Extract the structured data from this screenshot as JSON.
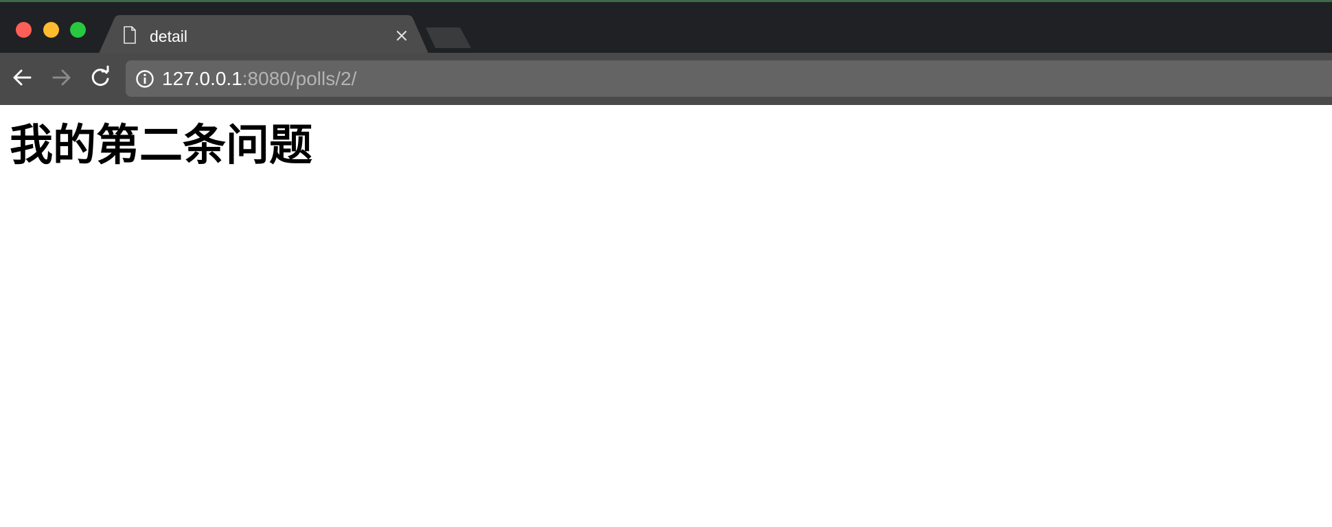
{
  "window": {
    "traffic_lights": {
      "close_color": "#fe5f57",
      "minimize_color": "#febc2e",
      "maximize_color": "#28c840"
    }
  },
  "tab": {
    "title": "detail",
    "icon": "document-icon",
    "close_icon": "close-icon"
  },
  "toolbar": {
    "back_icon": "arrow-left-icon",
    "forward_icon": "arrow-right-icon",
    "reload_icon": "reload-icon",
    "address": {
      "info_icon": "info-icon",
      "host": "127.0.0.1",
      "rest": ":8080/polls/2/"
    }
  },
  "page": {
    "heading": "我的第二条问题"
  }
}
